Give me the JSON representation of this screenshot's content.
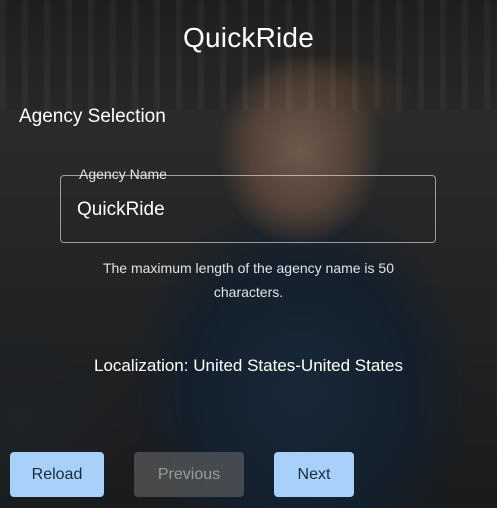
{
  "app": {
    "title": "QuickRide"
  },
  "section": {
    "heading": "Agency Selection"
  },
  "agency_field": {
    "label": "Agency Name",
    "value": "QuickRide",
    "helper": "The maximum length of the agency name is 50 characters."
  },
  "localization": {
    "text": "Localization: United States-United States"
  },
  "buttons": {
    "reload": "Reload",
    "previous": "Previous",
    "next": "Next"
  },
  "colors": {
    "button_primary": "#a8d1fa",
    "button_disabled": "#6e6e6e"
  }
}
